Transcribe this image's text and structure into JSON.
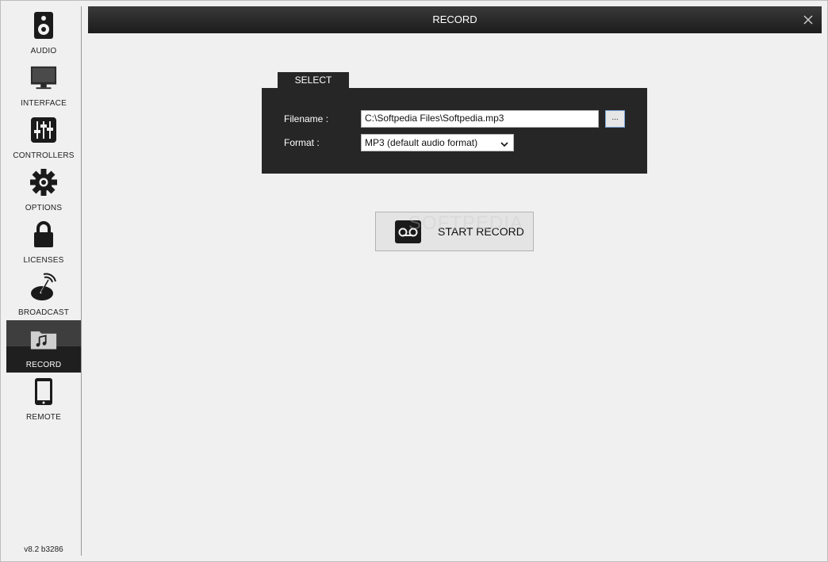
{
  "sidebar": {
    "items": [
      {
        "label": "AUDIO",
        "icon": "speaker-icon",
        "active": false
      },
      {
        "label": "INTERFACE",
        "icon": "monitor-icon",
        "active": false
      },
      {
        "label": "CONTROLLERS",
        "icon": "mixer-faders-icon",
        "active": false
      },
      {
        "label": "OPTIONS",
        "icon": "gear-icon",
        "active": false
      },
      {
        "label": "LICENSES",
        "icon": "lock-icon",
        "active": false
      },
      {
        "label": "BROADCAST",
        "icon": "broadcast-dish-icon",
        "active": false
      },
      {
        "label": "RECORD",
        "icon": "music-folder-icon",
        "active": true
      },
      {
        "label": "REMOTE",
        "icon": "phone-icon",
        "active": false
      }
    ],
    "version": "v8.2 b3286"
  },
  "titlebar": {
    "title": "RECORD",
    "close_icon": "close-icon"
  },
  "select_panel": {
    "tab_label": "SELECT",
    "filename_label": "Filename :",
    "filename_value": "C:\\Softpedia Files\\Softpedia.mp3",
    "browse_label": "...",
    "format_label": "Format :",
    "format_value": "MP3 (default audio format)"
  },
  "start_record": {
    "label": "START RECORD",
    "icon": "cassette-icon"
  },
  "watermark": "SOFTPEDIA",
  "colors": {
    "background": "#f0f0f0",
    "titlebar": "#2a2a2a",
    "panel": "#262626",
    "active_nav": "#2e2e2e"
  }
}
